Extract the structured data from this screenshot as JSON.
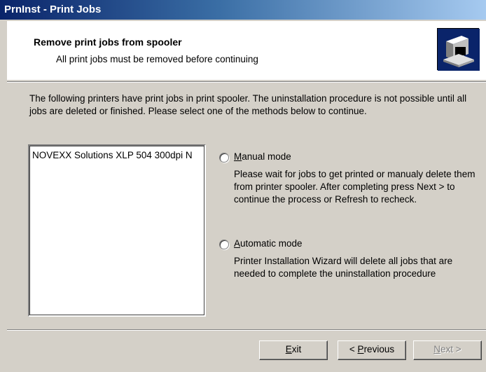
{
  "window": {
    "title": "PrnInst - Print Jobs"
  },
  "header": {
    "title": "Remove print jobs from spooler",
    "subtitle": "All print jobs must be removed before continuing",
    "icon": "printer-computer-icon"
  },
  "intro": "The following printers have print jobs in print spooler. The uninstallation procedure is not possible until all jobs are deleted or finished. Please select one of the methods below to continue.",
  "printers": [
    "NOVEXX Solutions XLP 504 300dpi N"
  ],
  "options": {
    "manual": {
      "accel": "M",
      "label_rest": "anual mode",
      "description": "Please wait for jobs to get printed or manualy delete them from printer spooler. After completing press Next > to continue the process or Refresh to recheck.",
      "selected": false
    },
    "automatic": {
      "accel": "A",
      "label_rest": "utomatic mode",
      "description": "Printer Installation Wizard will delete all jobs that are needed to complete the uninstallation procedure",
      "selected": false
    }
  },
  "buttons": {
    "exit_accel": "E",
    "exit_rest": "xit",
    "previous_prefix": "< ",
    "previous_accel": "P",
    "previous_rest": "revious",
    "next_accel": "N",
    "next_rest": "ext >",
    "next_enabled": false
  }
}
